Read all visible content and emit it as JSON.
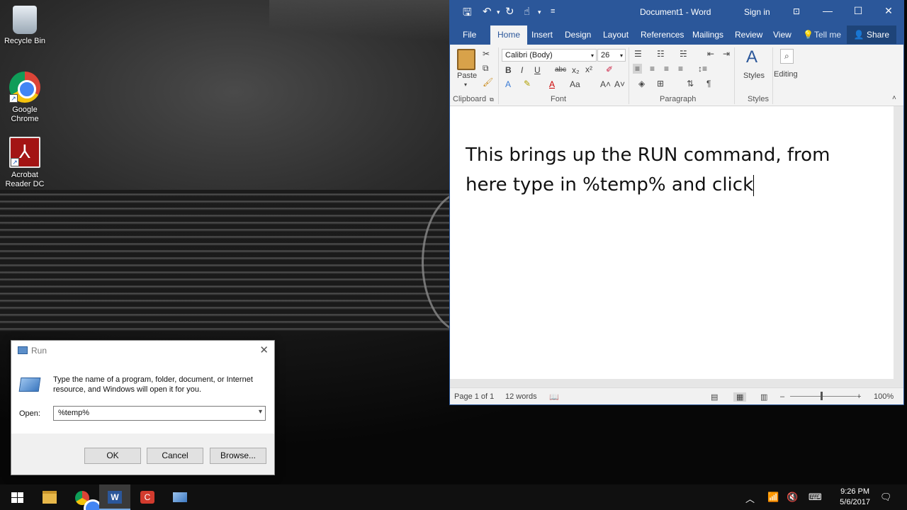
{
  "desktop": {
    "icons": [
      {
        "label": "Recycle Bin"
      },
      {
        "label": "Google Chrome"
      },
      {
        "label": "Acrobat Reader DC"
      }
    ]
  },
  "word": {
    "window_title": "Document1  -  Word",
    "sign_in": "Sign in",
    "tabs": [
      "File",
      "Home",
      "Insert",
      "Design",
      "Layout",
      "References",
      "Mailings",
      "Review",
      "View",
      "Tell me"
    ],
    "share": "Share",
    "ribbon": {
      "paste": "Paste",
      "font_name": "Calibri (Body)",
      "font_size": "26",
      "styles": "Styles",
      "editing": "Editing",
      "groups": [
        "Clipboard",
        "Font",
        "Paragraph",
        "Styles"
      ]
    },
    "document_text": "This brings up the RUN command, from here type in %temp% and click",
    "status": {
      "page": "Page 1 of 1",
      "words": "12 words",
      "zoom": "100%"
    }
  },
  "run_dialog": {
    "title": "Run",
    "message": "Type the name of a program, folder, document, or Internet resource, and Windows will open it for you.",
    "open_label": "Open:",
    "open_value": "%temp%",
    "buttons": {
      "ok": "OK",
      "cancel": "Cancel",
      "browse": "Browse..."
    }
  },
  "taskbar": {
    "time": "9:26 PM",
    "date": "5/6/2017"
  }
}
